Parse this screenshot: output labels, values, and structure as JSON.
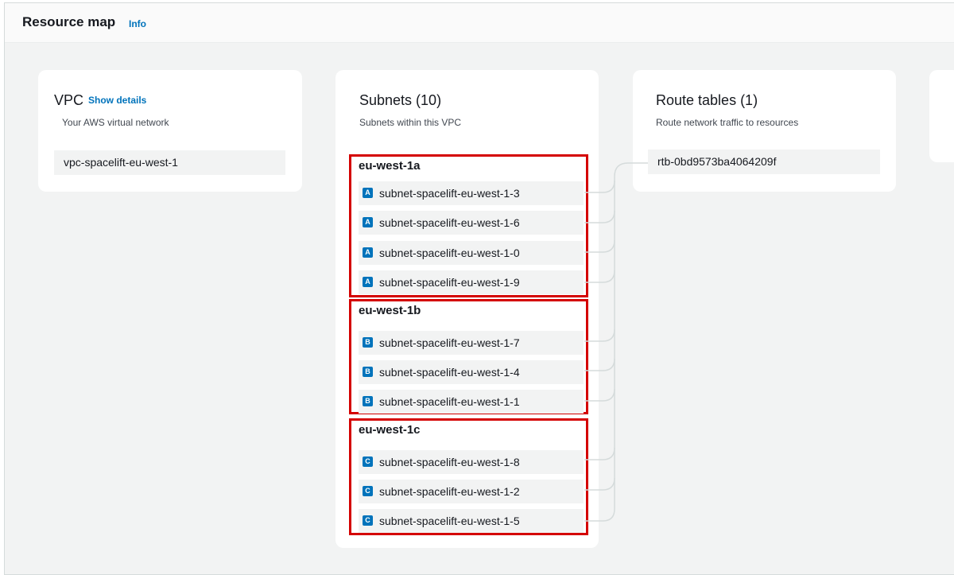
{
  "panel": {
    "title": "Resource map",
    "info_label": "Info"
  },
  "vpc": {
    "title": "VPC",
    "show_details_label": "Show details",
    "subtitle": "Your AWS virtual network",
    "item": "vpc-spacelift-eu-west-1"
  },
  "subnets": {
    "title": "Subnets (10)",
    "subtitle": "Subnets within this VPC",
    "zones": [
      {
        "name": "eu-west-1a",
        "badge": "A",
        "items": [
          "subnet-spacelift-eu-west-1-3",
          "subnet-spacelift-eu-west-1-6",
          "subnet-spacelift-eu-west-1-0",
          "subnet-spacelift-eu-west-1-9"
        ]
      },
      {
        "name": "eu-west-1b",
        "badge": "B",
        "items": [
          "subnet-spacelift-eu-west-1-7",
          "subnet-spacelift-eu-west-1-4",
          "subnet-spacelift-eu-west-1-1"
        ]
      },
      {
        "name": "eu-west-1c",
        "badge": "C",
        "items": [
          "subnet-spacelift-eu-west-1-8",
          "subnet-spacelift-eu-west-1-2",
          "subnet-spacelift-eu-west-1-5"
        ]
      }
    ]
  },
  "route_tables": {
    "title": "Route tables (1)",
    "subtitle": "Route network traffic to resources",
    "item": "rtb-0bd9573ba4064209f"
  },
  "colors": {
    "accent": "#0073bb",
    "highlight_border": "#d40000",
    "connector": "#d5dbdb"
  }
}
